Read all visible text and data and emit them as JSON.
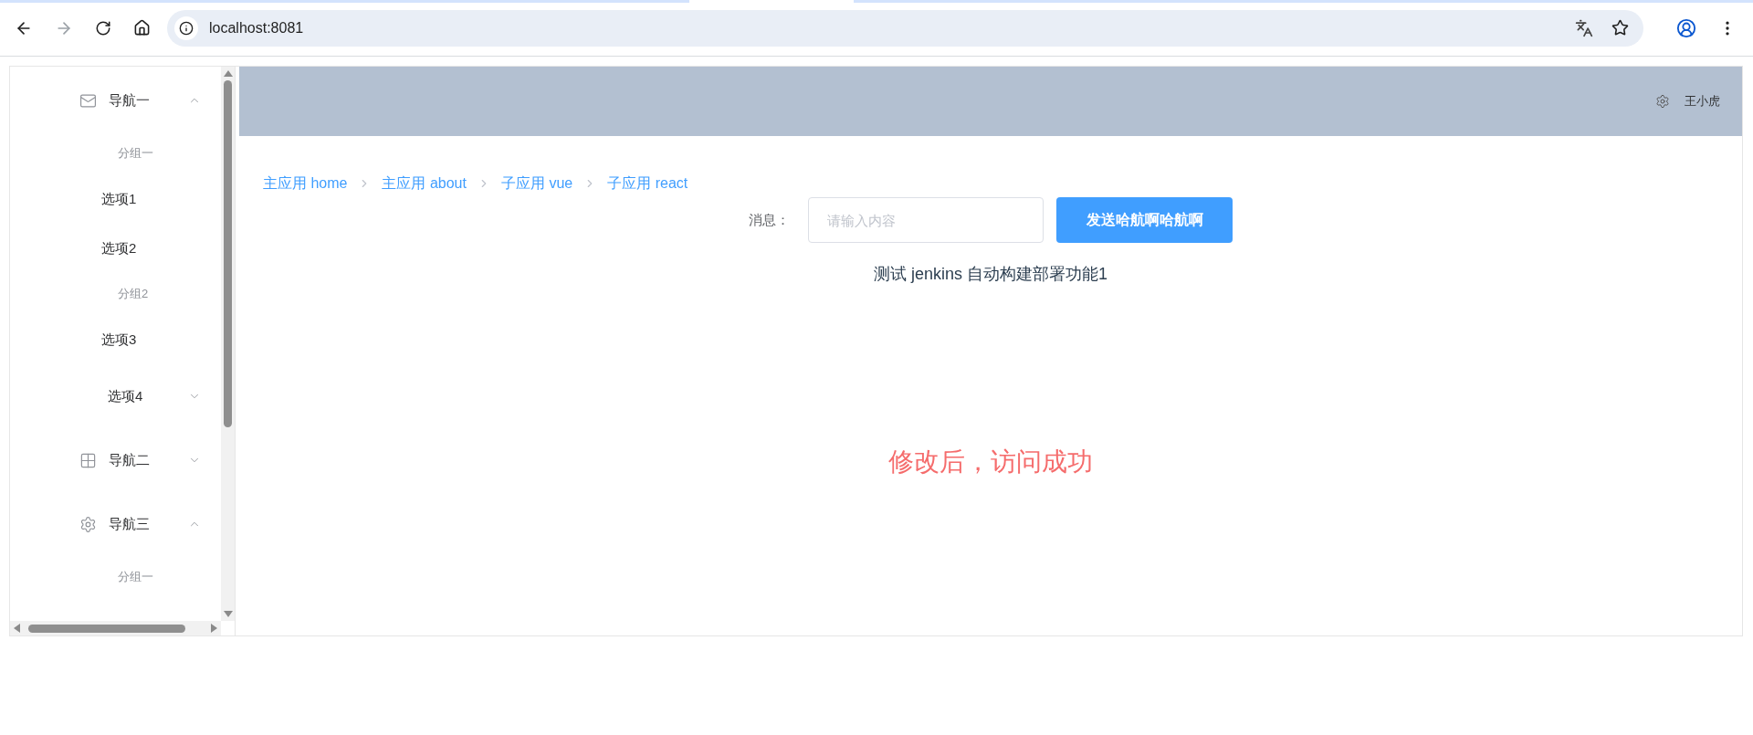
{
  "browser": {
    "url": "localhost:8081",
    "back_enabled": true,
    "forward_enabled": false
  },
  "sidebar": {
    "menu": [
      {
        "kind": "submenu",
        "label": "导航一",
        "expanded": true,
        "children": [
          {
            "kind": "group",
            "label": "分组一"
          },
          {
            "kind": "item",
            "label": "选项1"
          },
          {
            "kind": "item",
            "label": "选项2"
          },
          {
            "kind": "group",
            "label": "分组2"
          },
          {
            "kind": "item",
            "label": "选项3"
          },
          {
            "kind": "submenu",
            "label": "选项4",
            "expanded": false
          }
        ]
      },
      {
        "kind": "submenu",
        "label": "导航二",
        "expanded": false
      },
      {
        "kind": "submenu",
        "label": "导航三",
        "expanded": true,
        "children": [
          {
            "kind": "group",
            "label": "分组一"
          }
        ]
      }
    ]
  },
  "header": {
    "user": "王小虎"
  },
  "breadcrumb": [
    "主应用 home",
    "主应用 about",
    "子应用 vue",
    "子应用 react"
  ],
  "message_form": {
    "label": "消息：",
    "placeholder": "请输入内容",
    "button": "发送哈航啊哈航啊"
  },
  "info_text": "测试 jenkins 自动构建部署功能1",
  "status_text": "修改后，访问成功"
}
